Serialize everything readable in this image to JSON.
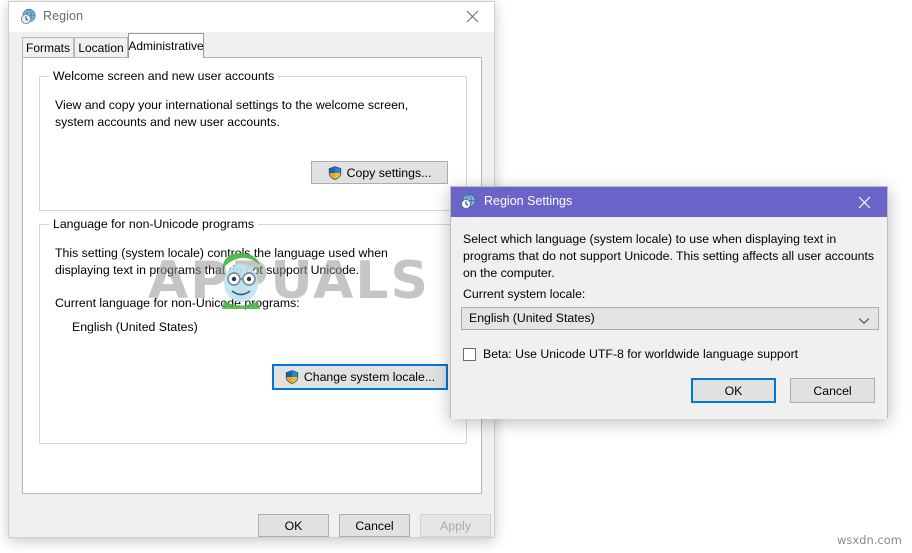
{
  "region_window": {
    "title": "Region",
    "title_icon": "region-globe-clock-icon",
    "close_icon": "close-icon",
    "tabs": [
      {
        "label": "Formats",
        "active": false
      },
      {
        "label": "Location",
        "active": false
      },
      {
        "label": "Administrative",
        "active": true
      }
    ],
    "welcome_group": {
      "title": "Welcome screen and new user accounts",
      "description": "View and copy your international settings to the welcome screen, system accounts and new user accounts.",
      "button_label": "Copy settings...",
      "button_icon": "uac-shield-icon"
    },
    "language_group": {
      "title": "Language for non-Unicode programs",
      "description": "This setting (system locale) controls the language used when displaying text in programs that do not support Unicode.",
      "current_label": "Current language for non-Unicode programs:",
      "current_value": "English (United States)",
      "button_label": "Change system locale...",
      "button_icon": "uac-shield-icon"
    },
    "footer_buttons": [
      {
        "label": "OK",
        "disabled": false
      },
      {
        "label": "Cancel",
        "disabled": false
      },
      {
        "label": "Apply",
        "disabled": true
      }
    ]
  },
  "region_settings_dialog": {
    "title": "Region Settings",
    "title_icon": "region-globe-clock-icon",
    "close_icon": "close-icon",
    "titlebar_color": "#6b64c8",
    "accent_color": "#0078d7",
    "description": "Select which language (system locale) to use when displaying text in programs that do not support Unicode. This setting affects all user accounts on the computer.",
    "locale_label": "Current system locale:",
    "locale_value": "English (United States)",
    "locale_dropdown_icon": "chevron-down-icon",
    "beta_checkbox": {
      "label": "Beta: Use Unicode UTF-8 for worldwide language support",
      "checked": false
    },
    "buttons": [
      {
        "label": "OK",
        "focused": true
      },
      {
        "label": "Cancel",
        "focused": false
      }
    ]
  },
  "watermarks": {
    "center_text": "APPUALS",
    "corner_text": "wsxdn.com"
  }
}
